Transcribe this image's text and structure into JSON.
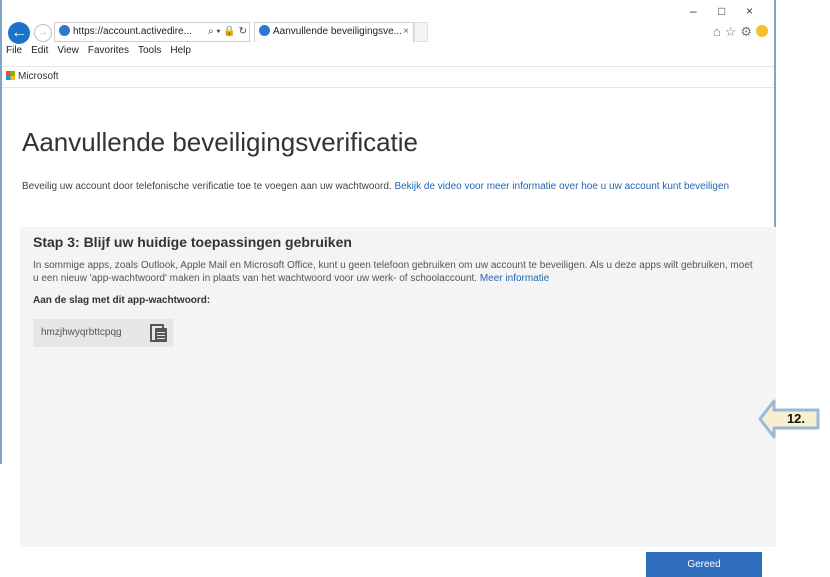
{
  "browser": {
    "address": "https://account.activedire...",
    "address_tools": "⌕ ▾ 🔒 ↻",
    "tab_title": "Aanvullende beveiligingsve...",
    "tab_close": "×",
    "minimize": "–",
    "maximize": "□",
    "close": "×"
  },
  "menu": [
    "File",
    "Edit",
    "View",
    "Favorites",
    "Tools",
    "Help"
  ],
  "brand": {
    "label": "Microsoft"
  },
  "page": {
    "title": "Aanvullende beveiligingsverificatie",
    "intro_text": "Beveilig uw account door telefonische verificatie toe te voegen aan uw wachtwoord. ",
    "intro_link": "Bekijk de video voor meer informatie over hoe u uw account kunt beveiligen"
  },
  "step": {
    "heading": "Stap 3: Blijf uw huidige toepassingen gebruiken",
    "text": "In sommige apps, zoals Outlook, Apple Mail en Microsoft Office, kunt u geen telefoon gebruiken om uw account te beveiligen. Als u deze apps wilt gebruiken, moet u een nieuw 'app-wachtwoord' maken in plaats van het wachtwoord voor uw werk- of schoolaccount. ",
    "link": "Meer informatie",
    "label": "Aan de slag met dit app-wachtwoord:",
    "password": "hmzjhwyqrbttcpqg"
  },
  "done_button": "Gereed",
  "callout": {
    "label": "12.",
    "color": "#f7f0d0",
    "border": "#9db7d6"
  }
}
